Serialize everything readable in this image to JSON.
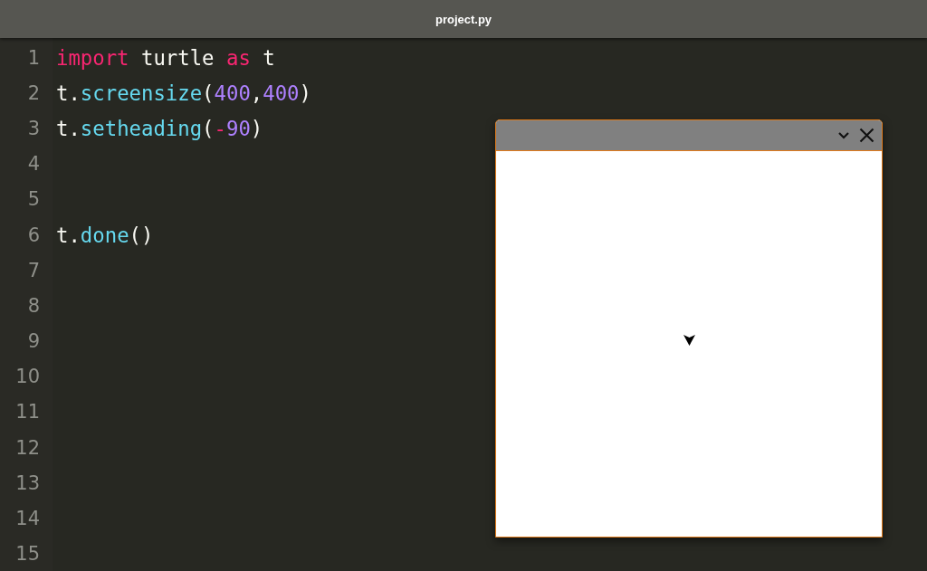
{
  "window": {
    "title": "project.py"
  },
  "editor": {
    "lines": [
      {
        "number": "1",
        "tokens": [
          {
            "text": "import",
            "kind": "keyword"
          },
          {
            "text": " turtle ",
            "kind": "plain"
          },
          {
            "text": "as",
            "kind": "keyword"
          },
          {
            "text": " t",
            "kind": "plain"
          }
        ]
      },
      {
        "number": "2",
        "tokens": [
          {
            "text": "t.",
            "kind": "plain"
          },
          {
            "text": "screensize",
            "kind": "function"
          },
          {
            "text": "(",
            "kind": "plain"
          },
          {
            "text": "400",
            "kind": "number"
          },
          {
            "text": ",",
            "kind": "plain"
          },
          {
            "text": "400",
            "kind": "number"
          },
          {
            "text": ")",
            "kind": "plain"
          }
        ]
      },
      {
        "number": "3",
        "tokens": [
          {
            "text": "t.",
            "kind": "plain"
          },
          {
            "text": "setheading",
            "kind": "function"
          },
          {
            "text": "(",
            "kind": "plain"
          },
          {
            "text": "-",
            "kind": "operator"
          },
          {
            "text": "90",
            "kind": "number"
          },
          {
            "text": ")",
            "kind": "plain"
          }
        ]
      },
      {
        "number": "4"
      },
      {
        "number": "5"
      },
      {
        "number": "6",
        "tokens": [
          {
            "text": "t.",
            "kind": "plain"
          },
          {
            "text": "done",
            "kind": "function"
          },
          {
            "text": "()",
            "kind": "plain"
          }
        ]
      },
      {
        "number": "7"
      },
      {
        "number": "8"
      },
      {
        "number": "9"
      },
      {
        "number": "10"
      },
      {
        "number": "11"
      },
      {
        "number": "12"
      },
      {
        "number": "13"
      },
      {
        "number": "14"
      },
      {
        "number": "15"
      }
    ]
  }
}
